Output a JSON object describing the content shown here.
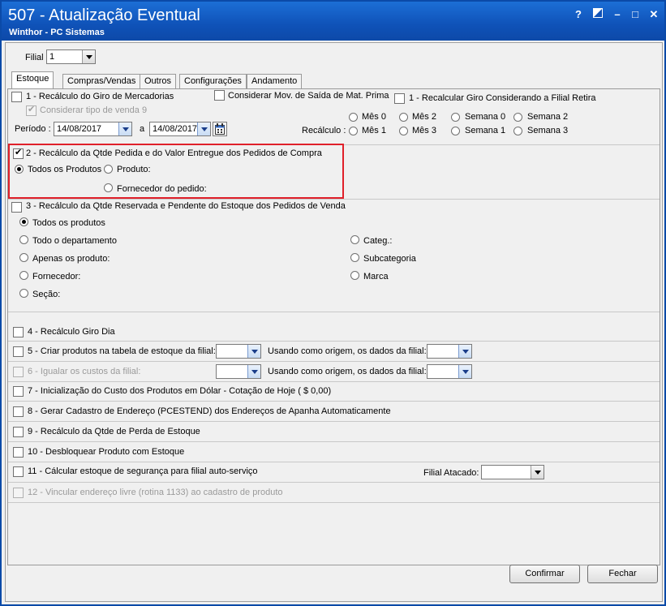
{
  "window": {
    "title": "507 - Atualização Eventual",
    "subtitle": "Winthor - PC Sistemas",
    "help_glyph": "?",
    "minimize_glyph": "–",
    "maximize_glyph": "□",
    "close_glyph": "✕"
  },
  "filial": {
    "label": "Filial",
    "value": "1"
  },
  "tabs": [
    {
      "label": "Estoque",
      "active": true
    },
    {
      "label": "Compras/Vendas"
    },
    {
      "label": "Outros"
    },
    {
      "label": "Configurações"
    },
    {
      "label": "Andamento"
    }
  ],
  "section1": {
    "opt1_label": "1 - Recálculo do Giro de Mercadorias",
    "consider_mov_label": "Considerar Mov. de Saída de Mat. Prima",
    "recalc_giro_label": "1 - Recalcular Giro Considerando a Filial Retira",
    "consider_venda9_label": "Considerar tipo de venda 9",
    "periodo_label": "Período :",
    "date_from": "14/08/2017",
    "a_label": "a",
    "date_to": "14/08/2017",
    "recalculo_label": "Recálculo :",
    "radios": [
      "Mês 0",
      "Mês 2",
      "Semana 0",
      "Semana 2",
      "Mês 1",
      "Mês 3",
      "Semana 1",
      "Semana 3"
    ]
  },
  "section2": {
    "label": "2 - Recálculo da Qtde Pedida e do Valor Entregue dos Pedidos de Compra",
    "todos_label": "Todos os Produtos",
    "produto_label": "Produto:",
    "fornecedor_label": "Fornecedor do pedido:"
  },
  "section3": {
    "label": "3 - Recálculo da Qtde Reservada e Pendente do Estoque dos Pedidos de Venda",
    "todos_label": "Todos os produtos",
    "depto_label": "Todo o departamento",
    "apenas_label": "Apenas os produto:",
    "fornecedor_label": "Fornecedor:",
    "secao_label": "Seção:",
    "categ_label": "Categ.:",
    "subcat_label": "Subcategoria",
    "marca_label": "Marca"
  },
  "options": {
    "opt4": "4 - Recálculo Giro Dia",
    "opt5": "5 - Criar produtos na tabela de estoque da filial:",
    "opt5_origin": "Usando como origem, os dados da filial:",
    "opt6": "6 - Igualar os custos da filial:",
    "opt6_origin": "Usando como origem, os dados da filial:",
    "opt7": "7 - Inicialização do Custo dos Produtos em Dólar - Cotação de Hoje ( $ 0,00)",
    "opt8": "8 - Gerar Cadastro de Endereço (PCESTEND) dos Endereços de Apanha Automaticamente",
    "opt9": "9 - Recálculo da Qtde de Perda de Estoque",
    "opt10": "10 - Desbloquear Produto com Estoque",
    "opt11": "11 - Cálcular estoque de segurança para filial auto-serviço",
    "filial_atacado": "Filial Atacado:",
    "opt12": "12 - Vincular endereço livre (rotina 1133) ao cadastro de produto"
  },
  "buttons": {
    "confirmar": "Confirmar",
    "fechar": "Fechar"
  }
}
